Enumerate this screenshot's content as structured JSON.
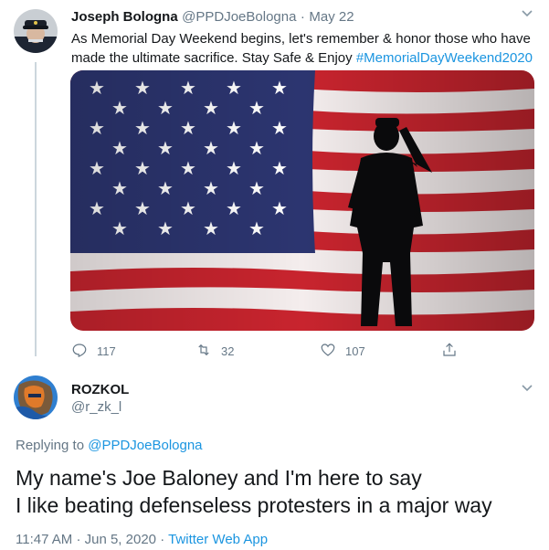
{
  "parent_tweet": {
    "author_name": "Joseph Bologna",
    "handle": "@PPDJoeBologna",
    "separator": "·",
    "date": "May 22",
    "text": "As Memorial Day Weekend begins, let's remember & honor those who have made the ultimate sacrifice. Stay Safe & Enjoy ",
    "hashtag": "#MemorialDayWeekend2020",
    "stats": {
      "replies": "117",
      "retweets": "32",
      "likes": "107"
    }
  },
  "reply_tweet": {
    "author_name": "ROZKOL",
    "handle": "@r_zk_l",
    "replying_prefix": "Replying to ",
    "replying_handle": "@PPDJoeBologna",
    "line1": "My name's Joe Baloney and I'm here to say",
    "line2": "I like beating defenseless protesters in a major way",
    "time": "11:47 AM",
    "separator": "·",
    "date": "Jun 5, 2020",
    "separator2": "·",
    "source": "Twitter Web App"
  },
  "icons": {
    "reply": "reply-icon",
    "retweet": "retweet-icon",
    "like": "like-icon",
    "share": "share-icon",
    "more": "chevron-down-icon"
  },
  "colors": {
    "accent": "#1b95e0",
    "muted": "#657786",
    "text": "#14171a"
  }
}
